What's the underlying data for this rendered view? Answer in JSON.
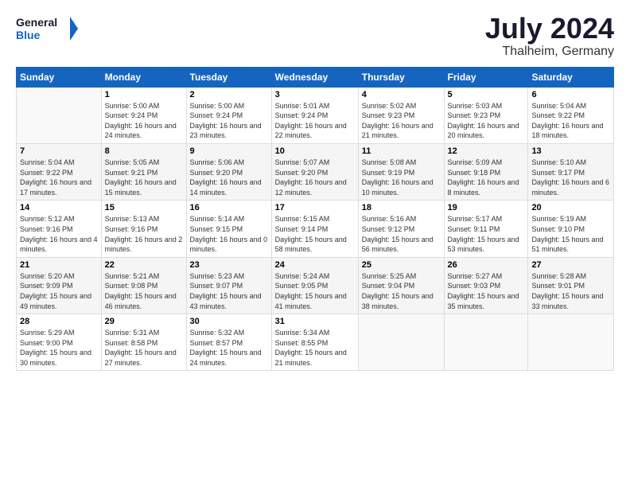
{
  "header": {
    "logo_line1": "General",
    "logo_line2": "Blue",
    "month": "July 2024",
    "location": "Thalheim, Germany"
  },
  "days_of_week": [
    "Sunday",
    "Monday",
    "Tuesday",
    "Wednesday",
    "Thursday",
    "Friday",
    "Saturday"
  ],
  "weeks": [
    [
      {
        "day": "",
        "sunrise": "",
        "sunset": "",
        "daylight": ""
      },
      {
        "day": "1",
        "sunrise": "Sunrise: 5:00 AM",
        "sunset": "Sunset: 9:24 PM",
        "daylight": "Daylight: 16 hours and 24 minutes."
      },
      {
        "day": "2",
        "sunrise": "Sunrise: 5:00 AM",
        "sunset": "Sunset: 9:24 PM",
        "daylight": "Daylight: 16 hours and 23 minutes."
      },
      {
        "day": "3",
        "sunrise": "Sunrise: 5:01 AM",
        "sunset": "Sunset: 9:24 PM",
        "daylight": "Daylight: 16 hours and 22 minutes."
      },
      {
        "day": "4",
        "sunrise": "Sunrise: 5:02 AM",
        "sunset": "Sunset: 9:23 PM",
        "daylight": "Daylight: 16 hours and 21 minutes."
      },
      {
        "day": "5",
        "sunrise": "Sunrise: 5:03 AM",
        "sunset": "Sunset: 9:23 PM",
        "daylight": "Daylight: 16 hours and 20 minutes."
      },
      {
        "day": "6",
        "sunrise": "Sunrise: 5:04 AM",
        "sunset": "Sunset: 9:22 PM",
        "daylight": "Daylight: 16 hours and 18 minutes."
      }
    ],
    [
      {
        "day": "7",
        "sunrise": "Sunrise: 5:04 AM",
        "sunset": "Sunset: 9:22 PM",
        "daylight": "Daylight: 16 hours and 17 minutes."
      },
      {
        "day": "8",
        "sunrise": "Sunrise: 5:05 AM",
        "sunset": "Sunset: 9:21 PM",
        "daylight": "Daylight: 16 hours and 15 minutes."
      },
      {
        "day": "9",
        "sunrise": "Sunrise: 5:06 AM",
        "sunset": "Sunset: 9:20 PM",
        "daylight": "Daylight: 16 hours and 14 minutes."
      },
      {
        "day": "10",
        "sunrise": "Sunrise: 5:07 AM",
        "sunset": "Sunset: 9:20 PM",
        "daylight": "Daylight: 16 hours and 12 minutes."
      },
      {
        "day": "11",
        "sunrise": "Sunrise: 5:08 AM",
        "sunset": "Sunset: 9:19 PM",
        "daylight": "Daylight: 16 hours and 10 minutes."
      },
      {
        "day": "12",
        "sunrise": "Sunrise: 5:09 AM",
        "sunset": "Sunset: 9:18 PM",
        "daylight": "Daylight: 16 hours and 8 minutes."
      },
      {
        "day": "13",
        "sunrise": "Sunrise: 5:10 AM",
        "sunset": "Sunset: 9:17 PM",
        "daylight": "Daylight: 16 hours and 6 minutes."
      }
    ],
    [
      {
        "day": "14",
        "sunrise": "Sunrise: 5:12 AM",
        "sunset": "Sunset: 9:16 PM",
        "daylight": "Daylight: 16 hours and 4 minutes."
      },
      {
        "day": "15",
        "sunrise": "Sunrise: 5:13 AM",
        "sunset": "Sunset: 9:16 PM",
        "daylight": "Daylight: 16 hours and 2 minutes."
      },
      {
        "day": "16",
        "sunrise": "Sunrise: 5:14 AM",
        "sunset": "Sunset: 9:15 PM",
        "daylight": "Daylight: 16 hours and 0 minutes."
      },
      {
        "day": "17",
        "sunrise": "Sunrise: 5:15 AM",
        "sunset": "Sunset: 9:14 PM",
        "daylight": "Daylight: 15 hours and 58 minutes."
      },
      {
        "day": "18",
        "sunrise": "Sunrise: 5:16 AM",
        "sunset": "Sunset: 9:12 PM",
        "daylight": "Daylight: 15 hours and 56 minutes."
      },
      {
        "day": "19",
        "sunrise": "Sunrise: 5:17 AM",
        "sunset": "Sunset: 9:11 PM",
        "daylight": "Daylight: 15 hours and 53 minutes."
      },
      {
        "day": "20",
        "sunrise": "Sunrise: 5:19 AM",
        "sunset": "Sunset: 9:10 PM",
        "daylight": "Daylight: 15 hours and 51 minutes."
      }
    ],
    [
      {
        "day": "21",
        "sunrise": "Sunrise: 5:20 AM",
        "sunset": "Sunset: 9:09 PM",
        "daylight": "Daylight: 15 hours and 49 minutes."
      },
      {
        "day": "22",
        "sunrise": "Sunrise: 5:21 AM",
        "sunset": "Sunset: 9:08 PM",
        "daylight": "Daylight: 15 hours and 46 minutes."
      },
      {
        "day": "23",
        "sunrise": "Sunrise: 5:23 AM",
        "sunset": "Sunset: 9:07 PM",
        "daylight": "Daylight: 15 hours and 43 minutes."
      },
      {
        "day": "24",
        "sunrise": "Sunrise: 5:24 AM",
        "sunset": "Sunset: 9:05 PM",
        "daylight": "Daylight: 15 hours and 41 minutes."
      },
      {
        "day": "25",
        "sunrise": "Sunrise: 5:25 AM",
        "sunset": "Sunset: 9:04 PM",
        "daylight": "Daylight: 15 hours and 38 minutes."
      },
      {
        "day": "26",
        "sunrise": "Sunrise: 5:27 AM",
        "sunset": "Sunset: 9:03 PM",
        "daylight": "Daylight: 15 hours and 35 minutes."
      },
      {
        "day": "27",
        "sunrise": "Sunrise: 5:28 AM",
        "sunset": "Sunset: 9:01 PM",
        "daylight": "Daylight: 15 hours and 33 minutes."
      }
    ],
    [
      {
        "day": "28",
        "sunrise": "Sunrise: 5:29 AM",
        "sunset": "Sunset: 9:00 PM",
        "daylight": "Daylight: 15 hours and 30 minutes."
      },
      {
        "day": "29",
        "sunrise": "Sunrise: 5:31 AM",
        "sunset": "Sunset: 8:58 PM",
        "daylight": "Daylight: 15 hours and 27 minutes."
      },
      {
        "day": "30",
        "sunrise": "Sunrise: 5:32 AM",
        "sunset": "Sunset: 8:57 PM",
        "daylight": "Daylight: 15 hours and 24 minutes."
      },
      {
        "day": "31",
        "sunrise": "Sunrise: 5:34 AM",
        "sunset": "Sunset: 8:55 PM",
        "daylight": "Daylight: 15 hours and 21 minutes."
      },
      {
        "day": "",
        "sunrise": "",
        "sunset": "",
        "daylight": ""
      },
      {
        "day": "",
        "sunrise": "",
        "sunset": "",
        "daylight": ""
      },
      {
        "day": "",
        "sunrise": "",
        "sunset": "",
        "daylight": ""
      }
    ]
  ]
}
